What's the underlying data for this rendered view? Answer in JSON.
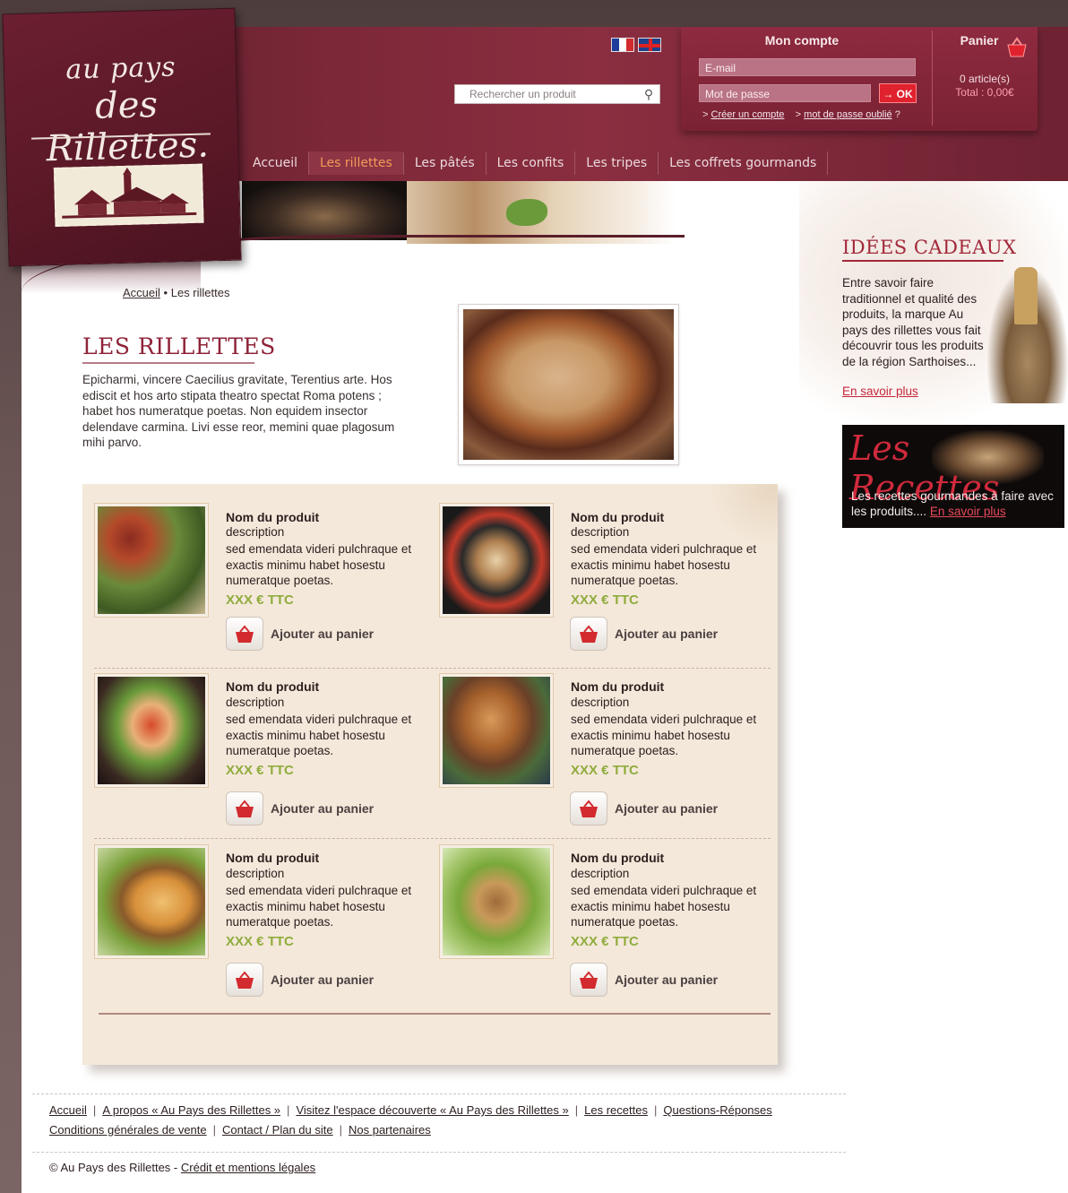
{
  "logo": {
    "line1": "au pays",
    "line2": "des Rillettes."
  },
  "search": {
    "placeholder": "Rechercher un produit",
    "icon": "magnifier-icon"
  },
  "languages": [
    "fr",
    "en"
  ],
  "account": {
    "title": "Mon compte",
    "email_placeholder": "E-mail",
    "password_placeholder": "Mot de passe",
    "ok_label": "→ OK",
    "create_prefix": ">",
    "create_label": "Créer un compte",
    "forgot_prefix": ">",
    "forgot_label": "mot de passe oublié",
    "forgot_suffix": "?"
  },
  "cart": {
    "title": "Panier",
    "count": "0 article(s)",
    "total": "Total : 0,00€",
    "icon": "basket-icon"
  },
  "nav": {
    "items": [
      {
        "label": "Accueil"
      },
      {
        "label": "Les rillettes",
        "active": true
      },
      {
        "label": "Les pâtés"
      },
      {
        "label": "Les confits"
      },
      {
        "label": "Les tripes"
      },
      {
        "label": "Les coffrets gourmands"
      }
    ]
  },
  "breadcrumb": {
    "home": "Accueil",
    "separator": "•",
    "current": "Les rillettes"
  },
  "intro": {
    "title": "LES RILLETTES",
    "text": "Epicharmi, vincere Caecilius gravitate, Terentius arte. Hos ediscit et hos arto stipata theatro spectat Roma potens ; habet hos numeratque poetas. Non equidem insector delendave carmina. Livi esse reor, memini quae plagosum mihi parvo."
  },
  "products": [
    {
      "name": "Nom du produit",
      "desc_label": "description",
      "desc": "sed emendata videri pulchraque et exactis minimu habet hosestu numeratque poetas.",
      "price": "XXX € TTC",
      "cta": "Ajouter au panier"
    },
    {
      "name": "Nom du produit",
      "desc_label": "description",
      "desc": "sed emendata videri pulchraque et exactis minimu habet hosestu numeratque poetas.",
      "price": "XXX € TTC",
      "cta": "Ajouter au panier"
    },
    {
      "name": "Nom du produit",
      "desc_label": "description",
      "desc": "sed emendata videri pulchraque et exactis minimu habet hosestu numeratque poetas.",
      "price": "XXX € TTC",
      "cta": "Ajouter au panier"
    },
    {
      "name": "Nom du produit",
      "desc_label": "description",
      "desc": "sed emendata videri pulchraque et exactis minimu habet hosestu numeratque poetas.",
      "price": "XXX € TTC",
      "cta": "Ajouter au panier"
    },
    {
      "name": "Nom du produit",
      "desc_label": "description",
      "desc": "sed emendata videri pulchraque et exactis minimu habet hosestu numeratque poetas.",
      "price": "XXX € TTC",
      "cta": "Ajouter au panier"
    },
    {
      "name": "Nom du produit",
      "desc_label": "description",
      "desc": "sed emendata videri pulchraque et exactis minimu habet hosestu numeratque poetas.",
      "price": "XXX € TTC",
      "cta": "Ajouter au panier"
    }
  ],
  "gift": {
    "title": "IDÉES CADEAUX",
    "text": "Entre savoir faire traditionnel et qualité des produits, la marque Au pays des rillettes vous fait découvrir tous les produits de la région Sarthoises...",
    "link": "En savoir plus"
  },
  "recipes": {
    "title": "Les Recettes",
    "text": "Les recettes gourmandes à faire avec les produits....",
    "link": "En savoir plus"
  },
  "footer": {
    "row1": [
      "Accueil",
      "A propos « Au Pays des Rillettes »",
      "Visitez l'espace découverte « Au Pays des Rillettes »",
      "Les recettes",
      "Questions-Réponses"
    ],
    "row2": [
      "Conditions générales de vente",
      "Contact  / Plan du site",
      "Nos partenaires"
    ],
    "separator": "|",
    "copyright": "© Au Pays des Rillettes -",
    "legal": "Crédit et mentions légales"
  },
  "colors": {
    "brand": "#7c2838",
    "accent": "#f39a5a",
    "price": "#8fac3c",
    "cart_red": "#d22a2e"
  }
}
